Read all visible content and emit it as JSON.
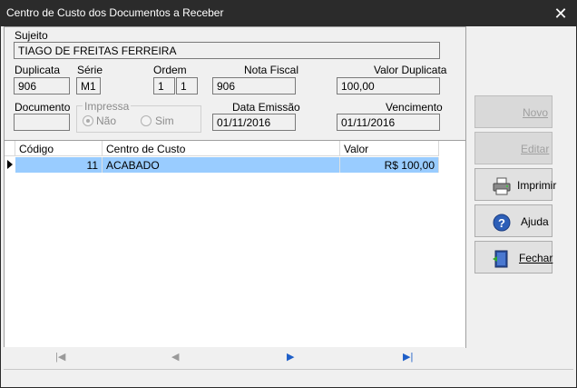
{
  "window": {
    "title": "Centro de Custo dos Documentos a Receber",
    "close_glyph": "✕"
  },
  "form": {
    "sujeito_label": "Sujeito",
    "sujeito_value": "TIAGO DE FREITAS FERREIRA",
    "duplicata_label": "Duplicata",
    "duplicata_value": "906",
    "serie_label": "Série",
    "serie_value": "M1",
    "ordem_label": "Ordem",
    "ordem_value_1": "1",
    "ordem_value_2": "1",
    "nota_fiscal_label": "Nota Fiscal",
    "nota_fiscal_value": "906",
    "valor_duplicata_label": "Valor Duplicata",
    "valor_duplicata_value": "100,00",
    "documento_label": "Documento",
    "documento_value": "",
    "impressa_label": "Impressa",
    "impressa_options": [
      {
        "label": "Não",
        "checked": true
      },
      {
        "label": "Sim",
        "checked": false
      }
    ],
    "data_emissao_label": "Data Emissão",
    "data_emissao_value": "01/11/2016",
    "vencimento_label": "Vencimento",
    "vencimento_value": "01/11/2016"
  },
  "grid": {
    "columns": [
      "Código",
      "Centro de Custo",
      "Valor"
    ],
    "rows": [
      {
        "codigo": "11",
        "centro": "ACABADO",
        "valor": "R$ 100,00"
      }
    ]
  },
  "buttons": {
    "novo": "Novo",
    "editar": "Editar",
    "imprimir": "Imprimir",
    "ajuda": "Ajuda",
    "fechar": "Fechar"
  },
  "nav_icons": [
    "first-record-icon",
    "prior-record-icon",
    "next-record-icon",
    "last-record-icon"
  ],
  "colors": {
    "titlebar": "#2b2b2b",
    "selected_row": "#99ccff"
  }
}
